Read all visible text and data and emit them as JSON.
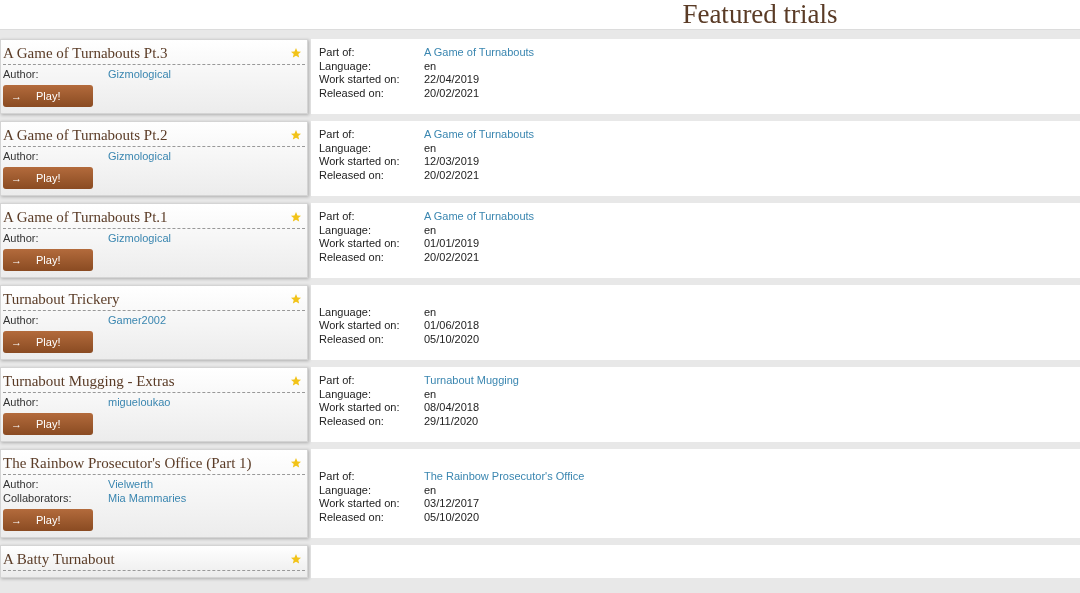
{
  "heading": "Featured trials",
  "trials": [
    {
      "title": "A Game of Turnabouts Pt.3",
      "people": [
        {
          "label": "Author:",
          "name": "Gizmological"
        }
      ],
      "play": "Play!",
      "arrow": "→",
      "details": [
        {
          "label": "Part of:",
          "value": "A Game of Turnabouts",
          "kind": "link"
        },
        {
          "label": "Language:",
          "value": "en",
          "kind": "text"
        },
        {
          "label": "Work started on:",
          "value": "22/04/2019",
          "kind": "text"
        },
        {
          "label": "Released on:",
          "value": "20/02/2021",
          "kind": "text"
        }
      ]
    },
    {
      "title": "A Game of Turnabouts Pt.2",
      "people": [
        {
          "label": "Author:",
          "name": "Gizmological"
        }
      ],
      "play": "Play!",
      "arrow": "→",
      "details": [
        {
          "label": "Part of:",
          "value": "A Game of Turnabouts",
          "kind": "link"
        },
        {
          "label": "Language:",
          "value": "en",
          "kind": "text"
        },
        {
          "label": "Work started on:",
          "value": "12/03/2019",
          "kind": "text"
        },
        {
          "label": "Released on:",
          "value": "20/02/2021",
          "kind": "text"
        }
      ]
    },
    {
      "title": "A Game of Turnabouts Pt.1",
      "people": [
        {
          "label": "Author:",
          "name": "Gizmological"
        }
      ],
      "play": "Play!",
      "arrow": "→",
      "details": [
        {
          "label": "Part of:",
          "value": "A Game of Turnabouts",
          "kind": "link"
        },
        {
          "label": "Language:",
          "value": "en",
          "kind": "text"
        },
        {
          "label": "Work started on:",
          "value": "01/01/2019",
          "kind": "text"
        },
        {
          "label": "Released on:",
          "value": "20/02/2021",
          "kind": "text"
        }
      ]
    },
    {
      "title": "Turnabout Trickery",
      "people": [
        {
          "label": "Author:",
          "name": "Gamer2002"
        }
      ],
      "play": "Play!",
      "arrow": "→",
      "details": [
        {
          "label": "Language:",
          "value": "en",
          "kind": "text"
        },
        {
          "label": "Work started on:",
          "value": "01/06/2018",
          "kind": "text"
        },
        {
          "label": "Released on:",
          "value": "05/10/2020",
          "kind": "text"
        }
      ]
    },
    {
      "title": "Turnabout Mugging - Extras",
      "people": [
        {
          "label": "Author:",
          "name": "migueloukao"
        }
      ],
      "play": "Play!",
      "arrow": "→",
      "details": [
        {
          "label": "Part of:",
          "value": "Turnabout Mugging",
          "kind": "link"
        },
        {
          "label": "Language:",
          "value": "en",
          "kind": "text"
        },
        {
          "label": "Work started on:",
          "value": "08/04/2018",
          "kind": "text"
        },
        {
          "label": "Released on:",
          "value": "29/11/2020",
          "kind": "text"
        }
      ]
    },
    {
      "title": "The Rainbow Prosecutor's Office (Part 1)",
      "people": [
        {
          "label": "Author:",
          "name": "Vielwerth"
        },
        {
          "label": "Collaborators:",
          "name": "Mia Mammaries"
        }
      ],
      "play": "Play!",
      "arrow": "→",
      "details": [
        {
          "label": "Part of:",
          "value": "The Rainbow Prosecutor's Office",
          "kind": "link"
        },
        {
          "label": "Language:",
          "value": "en",
          "kind": "text"
        },
        {
          "label": "Work started on:",
          "value": "03/12/2017",
          "kind": "text"
        },
        {
          "label": "Released on:",
          "value": "05/10/2020",
          "kind": "text"
        }
      ]
    },
    {
      "title": "A Batty Turnabout"
    }
  ]
}
